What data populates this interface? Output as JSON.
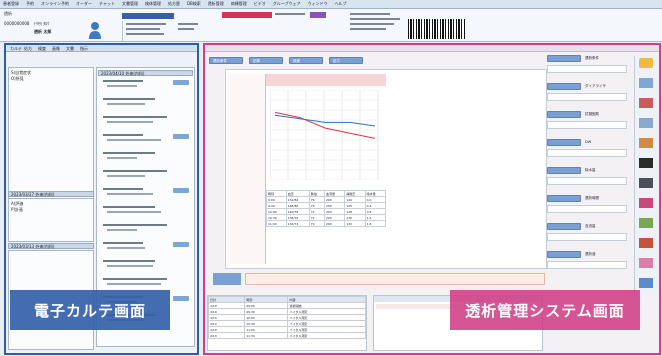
{
  "menu": [
    "患者登録",
    "予約",
    "オンライン予約",
    "オーダー",
    "チャット",
    "文書管理",
    "検体管理",
    "処方歴",
    "DB検索",
    "透析管理",
    "病棟管理",
    "ビデオ",
    "グループウェア",
    "ウィンドウ",
    "ヘルプ"
  ],
  "patient": {
    "id": "0000000008",
    "name_kana": "ﾄｳｾｷ ﾀﾛｳ",
    "name": "透析 太郎",
    "tag": "透析"
  },
  "captions": {
    "left": "電子カルテ画面",
    "right": "透析管理システム画面"
  },
  "left_panel": {
    "tabs": [
      "カルテ",
      "処方",
      "検査",
      "画像",
      "文書",
      "指示"
    ],
    "tree_sections": [
      "2023/04/10 外来(内科)",
      "2023/03/27 外来(内科)",
      "2023/03/13 外来(内科)"
    ],
    "items": [
      "S)自覚症状",
      "O)所見",
      "A)評価",
      "P)計画",
      "処方",
      "検査"
    ]
  },
  "right_panel": {
    "toolbar": [
      "透析条件",
      "記録",
      "検査",
      "処方"
    ],
    "grid_headers": [
      "時刻",
      "血圧",
      "脈拍",
      "血流量",
      "静脈圧",
      "除水量"
    ],
    "grid_rows": [
      [
        "9:00",
        "152/84",
        "76",
        "200",
        "120",
        "0.0"
      ],
      [
        "9:30",
        "148/80",
        "74",
        "200",
        "125",
        "0.4"
      ],
      [
        "10:00",
        "140/78",
        "72",
        "200",
        "128",
        "0.8"
      ],
      [
        "10:30",
        "136/76",
        "72",
        "200",
        "130",
        "1.2"
      ],
      [
        "11:00",
        "132/74",
        "70",
        "200",
        "132",
        "1.6"
      ]
    ],
    "side_labels": [
      "透析条件",
      "ダイアライザ",
      "抗凝固剤",
      "DW",
      "除水量",
      "透析時間",
      "血流量",
      "透析液"
    ],
    "bottom_headers": [
      "日付",
      "時刻",
      "内容"
    ],
    "bottom_rows": [
      [
        "4/10",
        "09:00",
        "透析開始"
      ],
      [
        "4/10",
        "09:30",
        "バイタル測定"
      ],
      [
        "4/10",
        "10:00",
        "バイタル測定"
      ],
      [
        "4/10",
        "10:30",
        "バイタル測定"
      ],
      [
        "4/10",
        "11:00",
        "バイタル測定"
      ],
      [
        "4/10",
        "11:30",
        "バイタル測定"
      ]
    ]
  },
  "chart_lines": {
    "colors": [
      "#d9363e",
      "#2f6fbe"
    ]
  }
}
